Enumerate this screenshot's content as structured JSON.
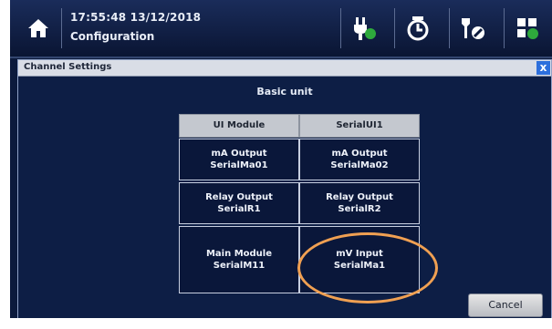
{
  "header": {
    "datetime": "17:55:48 13/12/2018",
    "title": "Configuration",
    "icons": [
      "home-icon",
      "power-plug-icon",
      "timer-icon",
      "wrench-icon",
      "grid-icon"
    ]
  },
  "dialog": {
    "title": "Channel Settings",
    "close_label": "x",
    "unit_title": "Basic unit",
    "columns": [
      {
        "header": "UI Module",
        "cells": [
          {
            "line1": "mA Output",
            "line2": "SerialMa01"
          },
          {
            "line1": "Relay Output",
            "line2": "SerialR1"
          },
          {
            "line1": "Main Module",
            "line2": "SerialM11"
          }
        ]
      },
      {
        "header": "SerialUI1",
        "cells": [
          {
            "line1": "mA Output",
            "line2": "SerialMa02"
          },
          {
            "line1": "Relay Output",
            "line2": "SerialR2"
          },
          {
            "line1": "mV Input",
            "line2": "SerialMa1"
          }
        ]
      }
    ],
    "cancel_label": "Cancel"
  },
  "colors": {
    "background": "#0c1a3c",
    "panel": "#0d1e45",
    "highlight": "#f0a052",
    "close_button": "#2d6fdc"
  }
}
